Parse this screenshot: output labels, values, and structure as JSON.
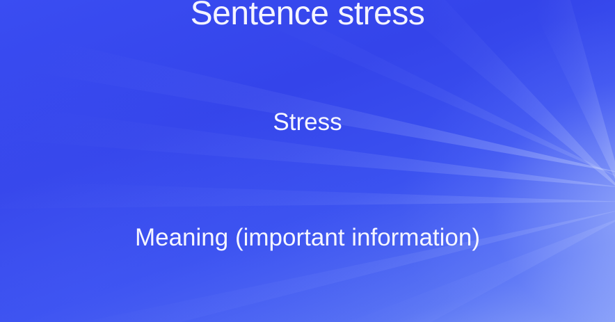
{
  "slide": {
    "title": "Sentence stress",
    "line1": "Stress",
    "line2": "Meaning (important information)"
  },
  "colors": {
    "background": "#3444ea",
    "text": "#ffffff",
    "ray_highlight": "#c8d7ff"
  }
}
